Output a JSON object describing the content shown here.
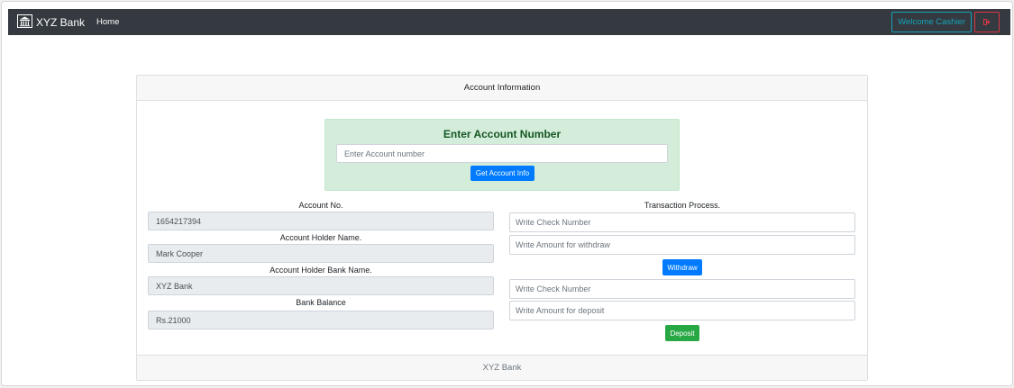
{
  "navbar": {
    "brand": "XYZ Bank",
    "home": "Home",
    "welcome": "Welcome Cashier"
  },
  "card": {
    "header": "Account Information",
    "footer": "XYZ Bank"
  },
  "search": {
    "title": "Enter Account Number",
    "placeholder": "Enter  Account number",
    "button": "Get Account Info"
  },
  "account": {
    "account_no_label": "Account No.",
    "account_no_value": "1654217394",
    "holder_name_label": "Account Holder Name.",
    "holder_name_value": "Mark Cooper",
    "bank_name_label": "Account Holder Bank Name.",
    "bank_name_value": "XYZ Bank",
    "balance_label": "Bank Balance",
    "balance_value": "Rs.21000"
  },
  "transaction": {
    "title": "Transaction Process.",
    "withdraw_check_placeholder": "Write Check Number",
    "withdraw_amount_placeholder": "Write Amount for withdraw",
    "withdraw_button": "Withdraw",
    "deposit_check_placeholder": "Write Check Number",
    "deposit_amount_placeholder": "Write Amount for deposit",
    "deposit_button": "Deposit"
  },
  "colors": {
    "navbar_bg": "#343a40",
    "primary": "#007bff",
    "success": "#28a745",
    "info": "#17a2b8",
    "danger": "#dc3545",
    "alert_bg": "#d4edda"
  }
}
